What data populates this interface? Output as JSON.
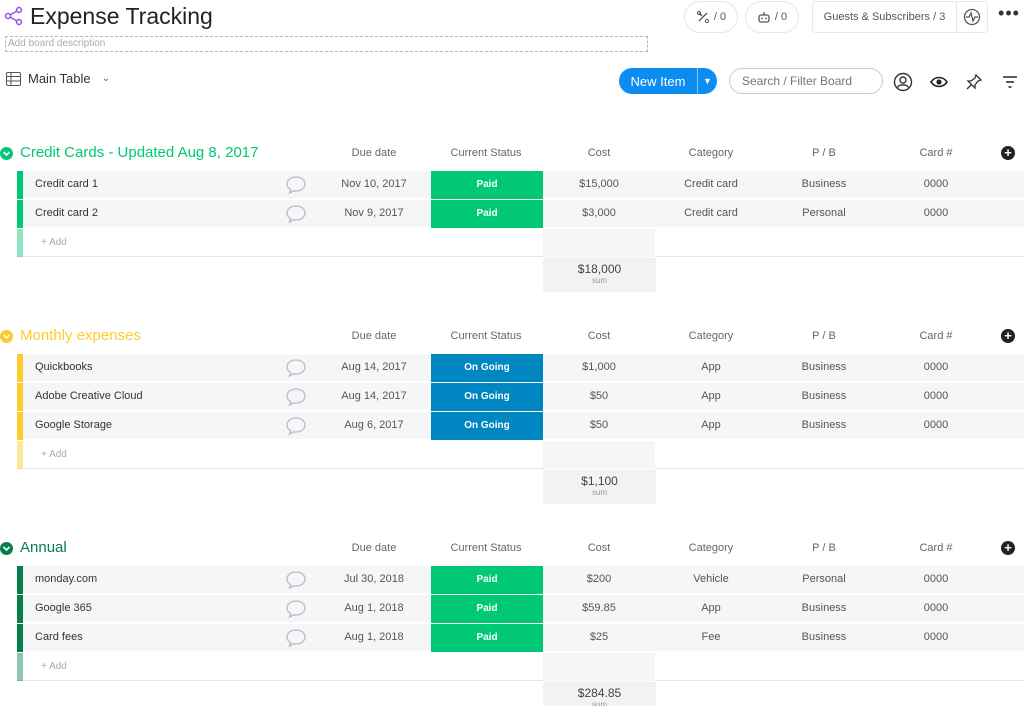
{
  "board": {
    "title": "Expense Tracking",
    "description_placeholder": "Add board description",
    "integrations": "/ 0",
    "automations": "/ 0",
    "guests": "Guests & Subscribers / 3"
  },
  "toolbar": {
    "view": "Main Table",
    "new_item": "New Item",
    "search_placeholder": "Search / Filter Board"
  },
  "columns": [
    "Due date",
    "Current Status",
    "Cost",
    "Category",
    "P / B",
    "Card #"
  ],
  "add_label": "+ Add",
  "sum_label": "sum",
  "colors": {
    "paid": "#00c875",
    "ongoing": "#0086c0",
    "accent": "#0a8cf0"
  },
  "groups": [
    {
      "title": "Credit Cards - Updated Aug 8, 2017",
      "color": "#00c875",
      "rows": [
        {
          "name": "Credit card 1",
          "due": "Nov 10, 2017",
          "status": "Paid",
          "cost": "$15,000",
          "category": "Credit card",
          "pb": "Business",
          "card": "0000"
        },
        {
          "name": "Credit card 2",
          "due": "Nov 9, 2017",
          "status": "Paid",
          "cost": "$3,000",
          "category": "Credit card",
          "pb": "Personal",
          "card": "0000"
        }
      ],
      "sum": "$18,000"
    },
    {
      "title": "Monthly expenses",
      "color": "#fdcc2c",
      "rows": [
        {
          "name": "Quickbooks",
          "due": "Aug 14, 2017",
          "status": "On Going",
          "cost": "$1,000",
          "category": "App",
          "pb": "Business",
          "card": "0000"
        },
        {
          "name": "Adobe Creative Cloud",
          "due": "Aug 14, 2017",
          "status": "On Going",
          "cost": "$50",
          "category": "App",
          "pb": "Business",
          "card": "0000"
        },
        {
          "name": "Google Storage",
          "due": "Aug 6, 2017",
          "status": "On Going",
          "cost": "$50",
          "category": "App",
          "pb": "Business",
          "card": "0000"
        }
      ],
      "sum": "$1,100"
    },
    {
      "title": "Annual",
      "color": "#037f4c",
      "rows": [
        {
          "name": "monday.com",
          "due": "Jul 30, 2018",
          "status": "Paid",
          "cost": "$200",
          "category": "Vehicle",
          "pb": "Personal",
          "card": "0000"
        },
        {
          "name": "Google 365",
          "due": "Aug 1, 2018",
          "status": "Paid",
          "cost": "$59.85",
          "category": "App",
          "pb": "Business",
          "card": "0000"
        },
        {
          "name": "Card fees",
          "due": "Aug 1, 2018",
          "status": "Paid",
          "cost": "$25",
          "category": "Fee",
          "pb": "Business",
          "card": "0000"
        }
      ],
      "sum": "$284.85"
    }
  ]
}
